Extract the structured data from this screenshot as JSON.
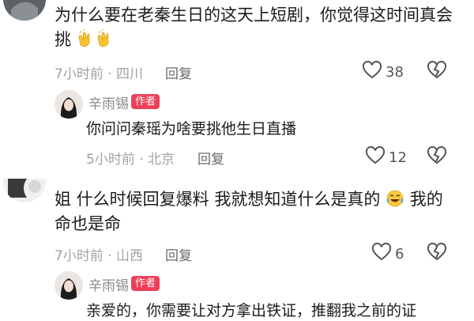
{
  "comments": [
    {
      "text": "为什么要在老秦生日的这天上短剧，你觉得这时间真会",
      "text_line2": "挑",
      "emoji": "clapping-hands-icon",
      "meta": "7小时前 · 四川",
      "reply_label": "回复",
      "likes": "38",
      "reply": {
        "author": "辛雨锡",
        "badge": "作者",
        "text": "你问问秦瑶为啥要挑他生日直播",
        "meta": "5小时前 · 北京",
        "reply_label": "回复",
        "likes": "12"
      }
    },
    {
      "text": "姐 什么时候回复爆料 我就想知道什么是真的",
      "text_tail": "我的",
      "text_line2": "命也是命",
      "emoji": "laughing-tears-icon",
      "meta": "7小时前 · 山西",
      "reply_label": "回复",
      "likes": "6",
      "reply": {
        "author": "辛雨锡",
        "badge": "作者",
        "text": "亲爱的，你需要让对方拿出铁证，推翻我之前的证"
      }
    }
  ],
  "colors": {
    "badge": "#ee3f58",
    "meta": "#a2a2a2",
    "text": "#1b1b1b"
  }
}
